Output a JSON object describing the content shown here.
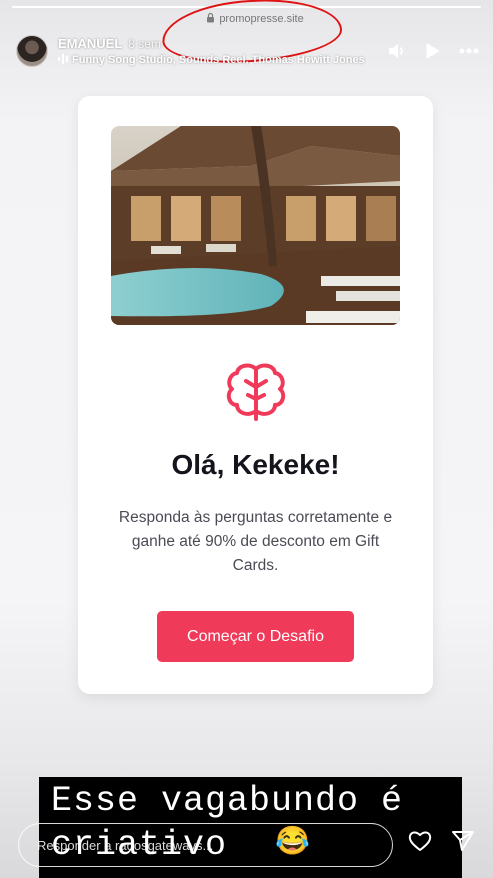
{
  "url_overlay": "promopresse.site",
  "progress_fraction": 1,
  "header": {
    "username": "EMANUEL",
    "time": "8 sem",
    "music": "Funny Song Studio, Sounds Reel, Thomas Hewitt Jones",
    "icons": [
      "volume-icon",
      "play-icon",
      "more-icon"
    ]
  },
  "card": {
    "title": "Olá, Kekeke!",
    "description": "Responda às perguntas corretamente e ganhe até 90% de desconto em Gift Cards.",
    "button_label": "Começar o Desafio",
    "accent_color": "#ef3a59"
  },
  "caption": {
    "line1": "Esse vagabundo é",
    "line2": "criativo",
    "emoji": "😂"
  },
  "reply": {
    "placeholder": "Responder a radosgateways..."
  }
}
